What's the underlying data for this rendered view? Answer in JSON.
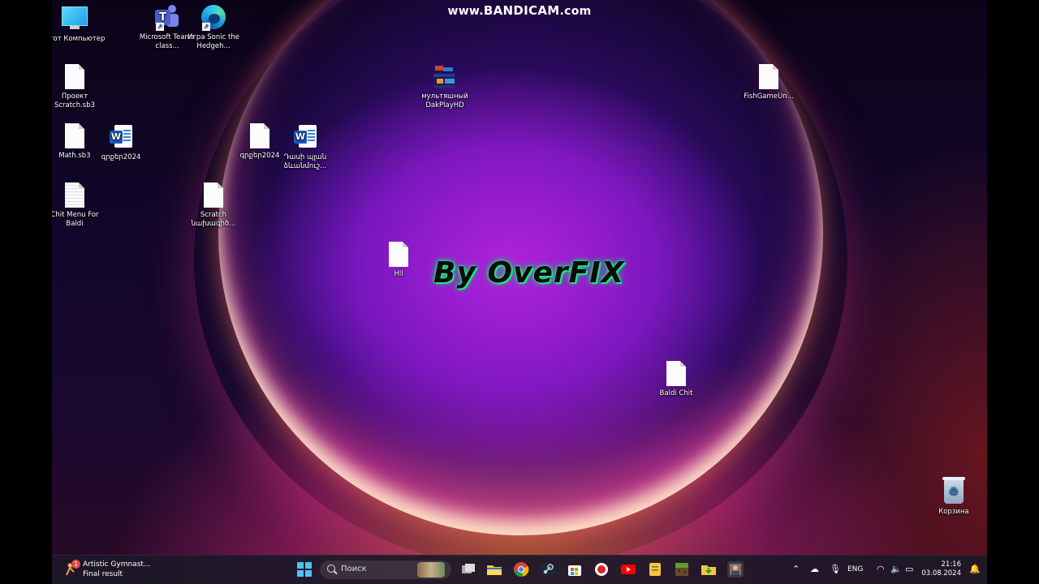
{
  "overlay": {
    "watermark_prefix": "www.",
    "watermark_brand": "BANDICAM",
    "watermark_suffix": ".com"
  },
  "desktop": {
    "icons": [
      {
        "id": "this-pc",
        "label": "Этот Компьютер",
        "kind": "computer"
      },
      {
        "id": "teams",
        "label": "Microsoft Teams class...",
        "kind": "teams"
      },
      {
        "id": "sonic",
        "label": "Игра Sonic the Hedgeh...",
        "kind": "edge"
      },
      {
        "id": "project-scratch",
        "label": "Проект Scratch.sb3",
        "kind": "file"
      },
      {
        "id": "dakplay",
        "label": "мультяшный DakPlayHD",
        "kind": "pixel"
      },
      {
        "id": "fishgame",
        "label": "FishGameUn...",
        "kind": "file"
      },
      {
        "id": "math",
        "label": "Math.sb3",
        "kind": "file"
      },
      {
        "id": "word-1",
        "label": "գրքեր2024",
        "kind": "word"
      },
      {
        "id": "file-2",
        "label": "գրքեր2024",
        "kind": "file"
      },
      {
        "id": "word-2",
        "label": "Դասի պլան ձևանմուշ...",
        "kind": "word"
      },
      {
        "id": "chit-menu",
        "label": "Chit Menu For Baldi",
        "kind": "file-lined"
      },
      {
        "id": "scratch-sample",
        "label": "Scratch նախագիծ...",
        "kind": "file"
      },
      {
        "id": "hll",
        "label": "Hll",
        "kind": "file"
      },
      {
        "id": "baldi-chit",
        "label": "Baldi Chit",
        "kind": "file"
      },
      {
        "id": "recycle-bin",
        "label": "Корзина",
        "kind": "bin"
      }
    ],
    "logo_text": "By OverFIX"
  },
  "taskbar": {
    "widget": {
      "title": "Artistic Gymnast...",
      "subtitle": "Final result",
      "badge": "1"
    },
    "search_placeholder": "Поиск",
    "apps": [
      "start",
      "task-view",
      "file-explorer",
      "chrome",
      "steam",
      "store",
      "recorder",
      "youtube",
      "notes",
      "minecraft",
      "downloader",
      "user-app"
    ],
    "tray": {
      "language": "ENG",
      "time": "21:16",
      "date": "03.08.2024"
    }
  }
}
